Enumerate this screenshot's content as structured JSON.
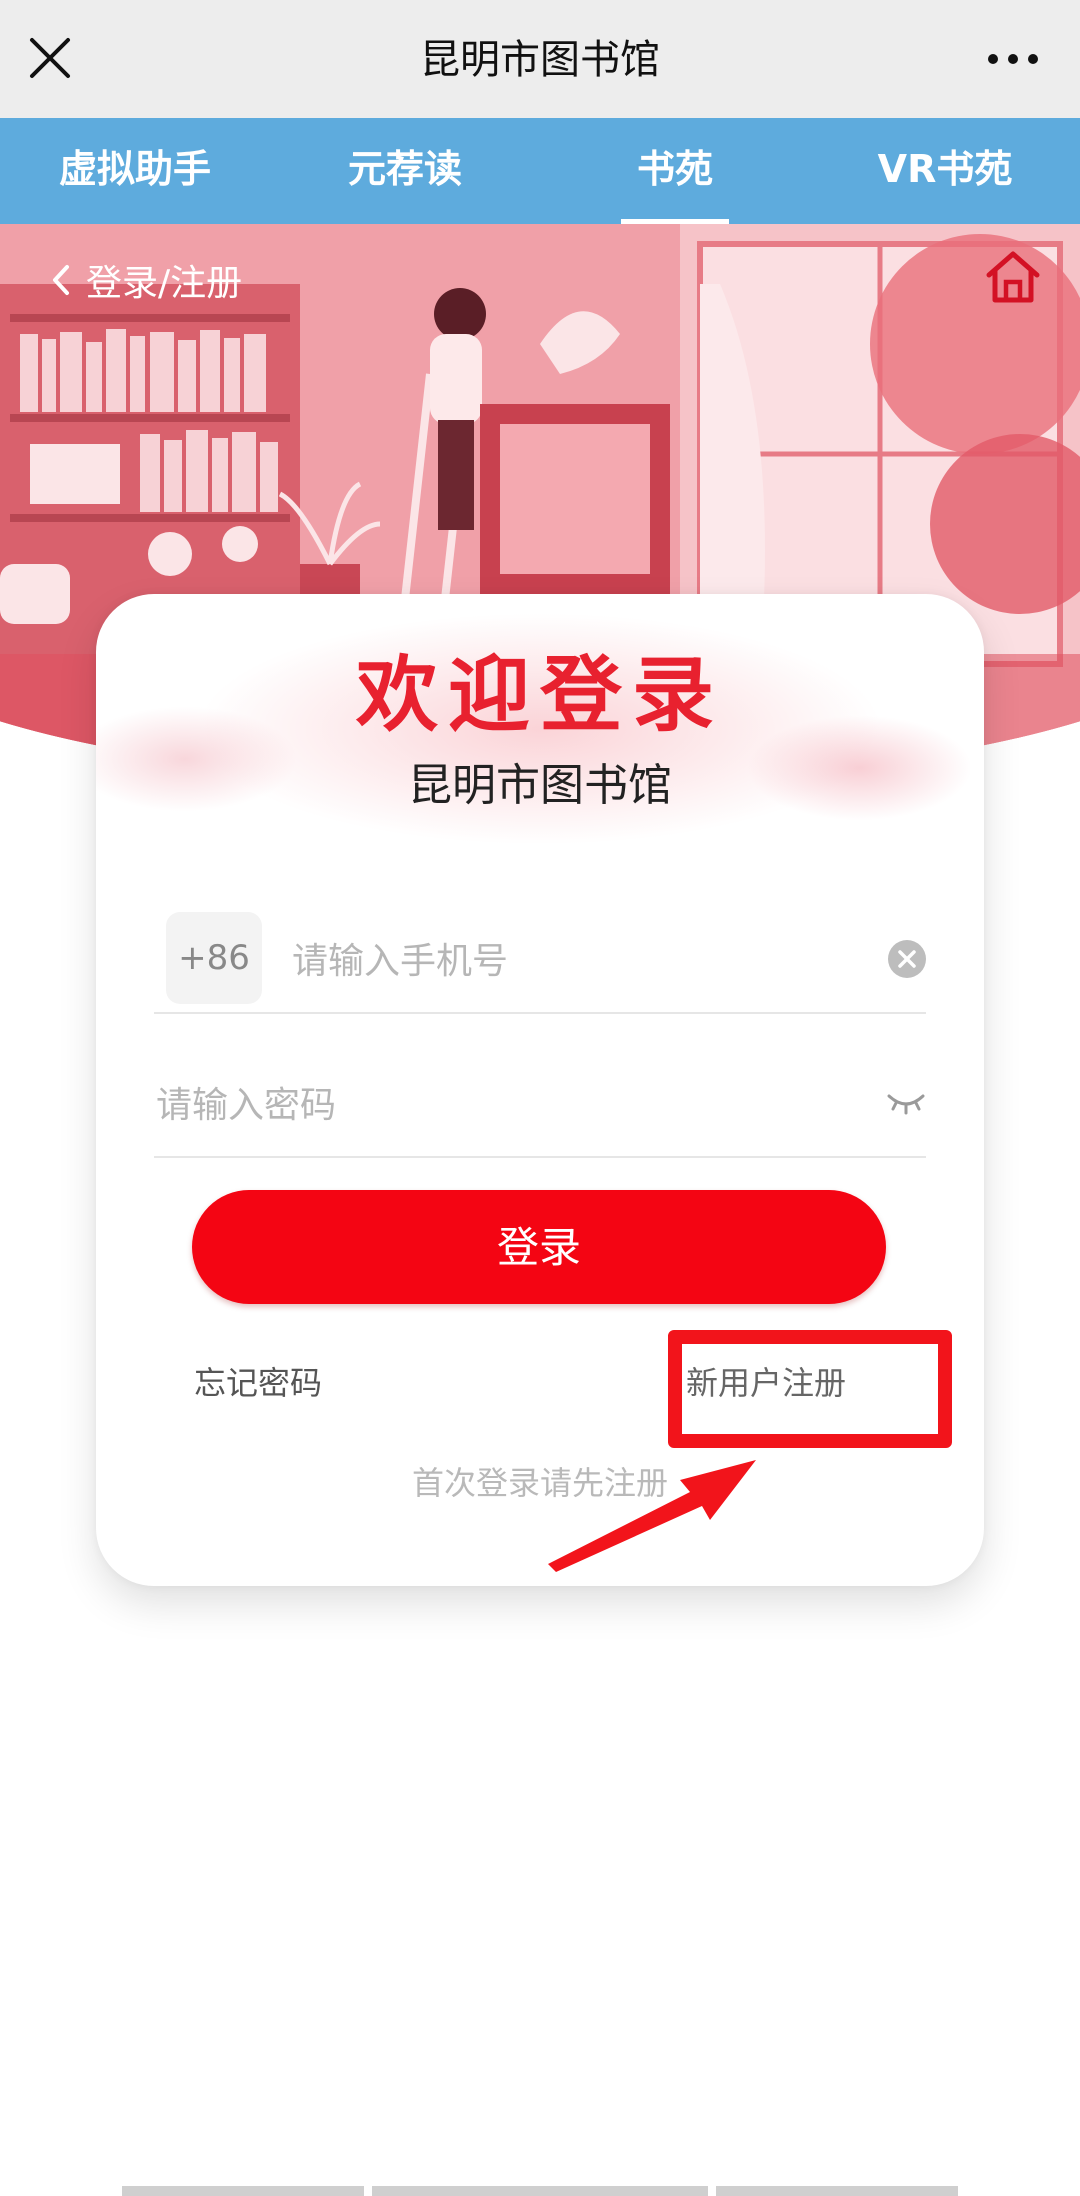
{
  "header": {
    "title": "昆明市图书馆"
  },
  "nav": {
    "tabs": [
      {
        "label": "虚拟助手",
        "active": false
      },
      {
        "label": "元荐读",
        "active": false
      },
      {
        "label": "书苑",
        "active": true
      },
      {
        "label": "VR书苑",
        "active": false
      }
    ]
  },
  "hero": {
    "back_label": "登录/注册"
  },
  "card": {
    "welcome": "欢迎登录",
    "subtitle": "昆明市图书馆",
    "country_code": "+86",
    "phone_placeholder": "请输入手机号",
    "password_placeholder": "请输入密码",
    "login_button": "登录",
    "forgot_password": "忘记密码",
    "register": "新用户注册",
    "hint": "首次登录请先注册"
  },
  "colors": {
    "nav_bg": "#5eabdd",
    "accent_red": "#f40513",
    "welcome_red": "#e8212f",
    "topbar_bg": "#ededed"
  },
  "icons": {
    "close": "close-icon",
    "more": "more-icon",
    "back": "chevron-left-icon",
    "home": "home-icon",
    "clear": "clear-icon",
    "eye": "eye-closed-icon"
  }
}
